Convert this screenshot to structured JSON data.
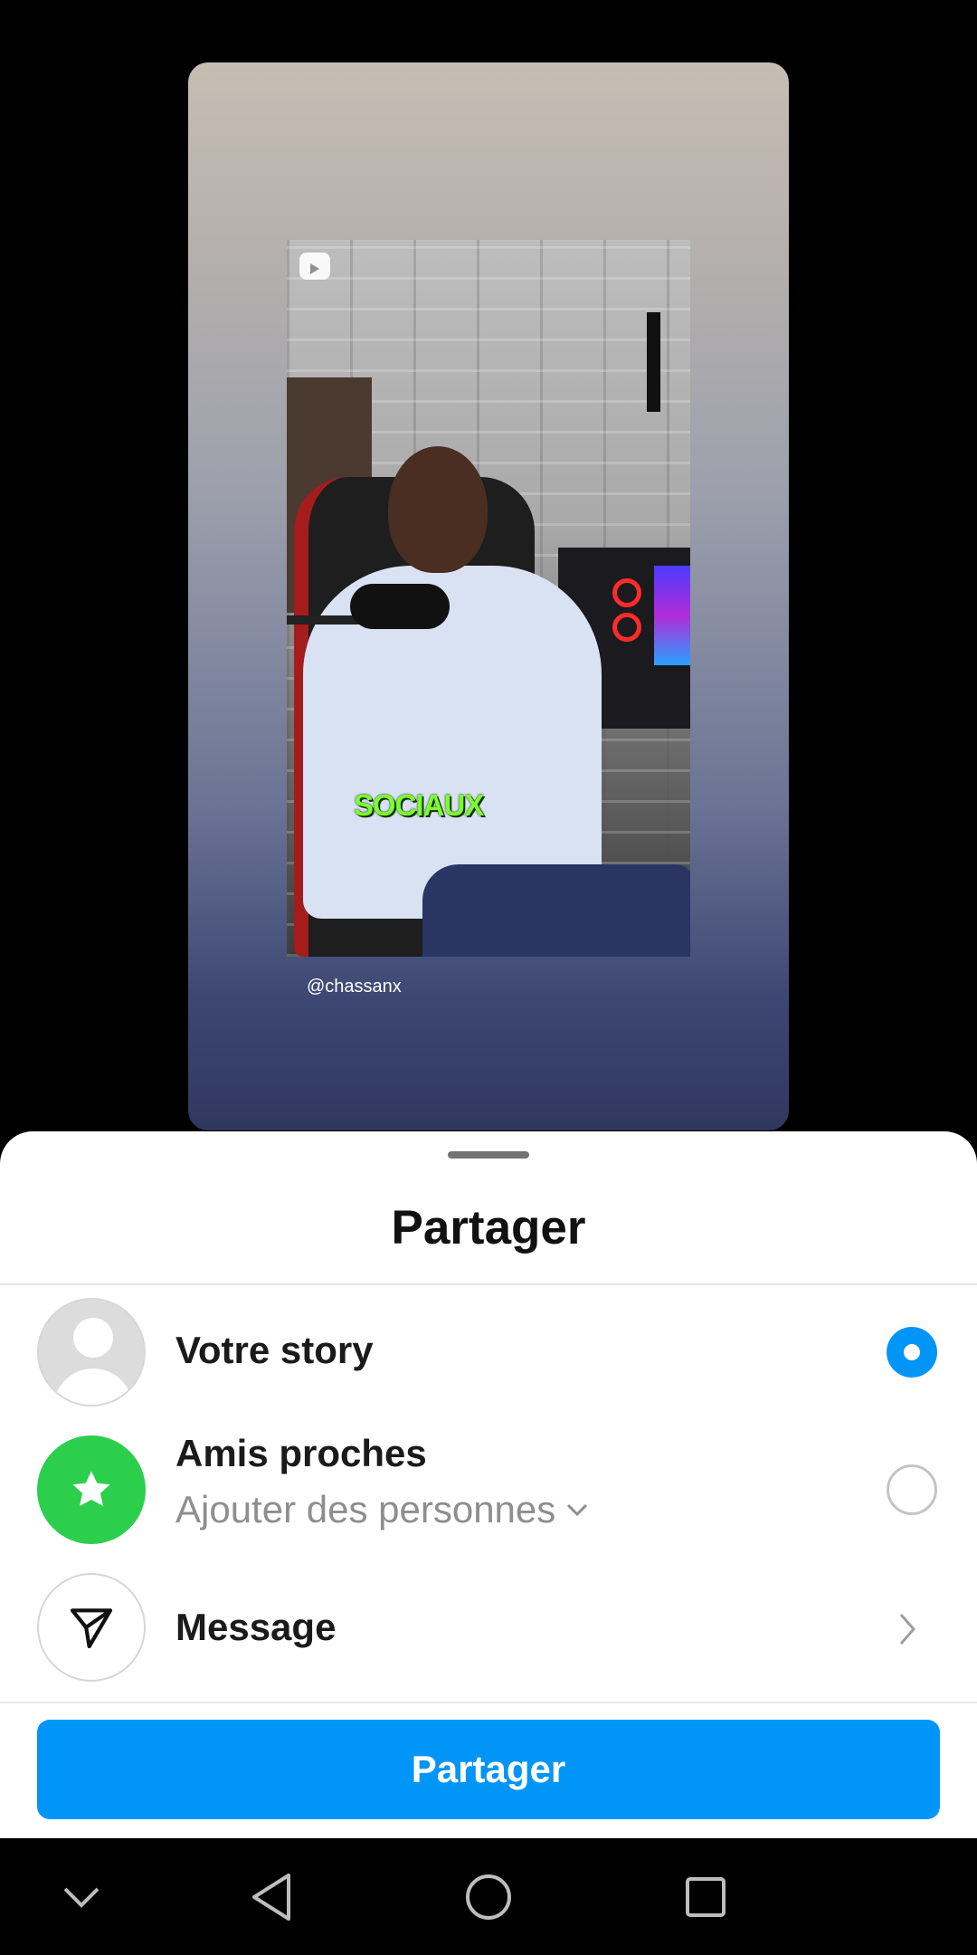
{
  "story_preview": {
    "caption_text": "SOCIAUX",
    "author_handle": "@chassanx"
  },
  "sheet": {
    "title": "Partager",
    "options": [
      {
        "label": "Votre story",
        "selected": true,
        "icon": "person-placeholder-icon"
      },
      {
        "label": "Amis proches",
        "sublabel": "Ajouter des personnes",
        "selected": false,
        "icon": "star-icon",
        "icon_bg": "#2bcf4b"
      },
      {
        "label": "Message",
        "icon": "paper-plane-icon"
      }
    ],
    "share_button_label": "Partager"
  },
  "colors": {
    "accent": "#0095f6",
    "close_friends": "#2bcf4b"
  },
  "navbar": {
    "buttons": [
      "chevron-down-icon",
      "back-triangle-icon",
      "home-circle-icon",
      "recents-square-icon"
    ]
  }
}
